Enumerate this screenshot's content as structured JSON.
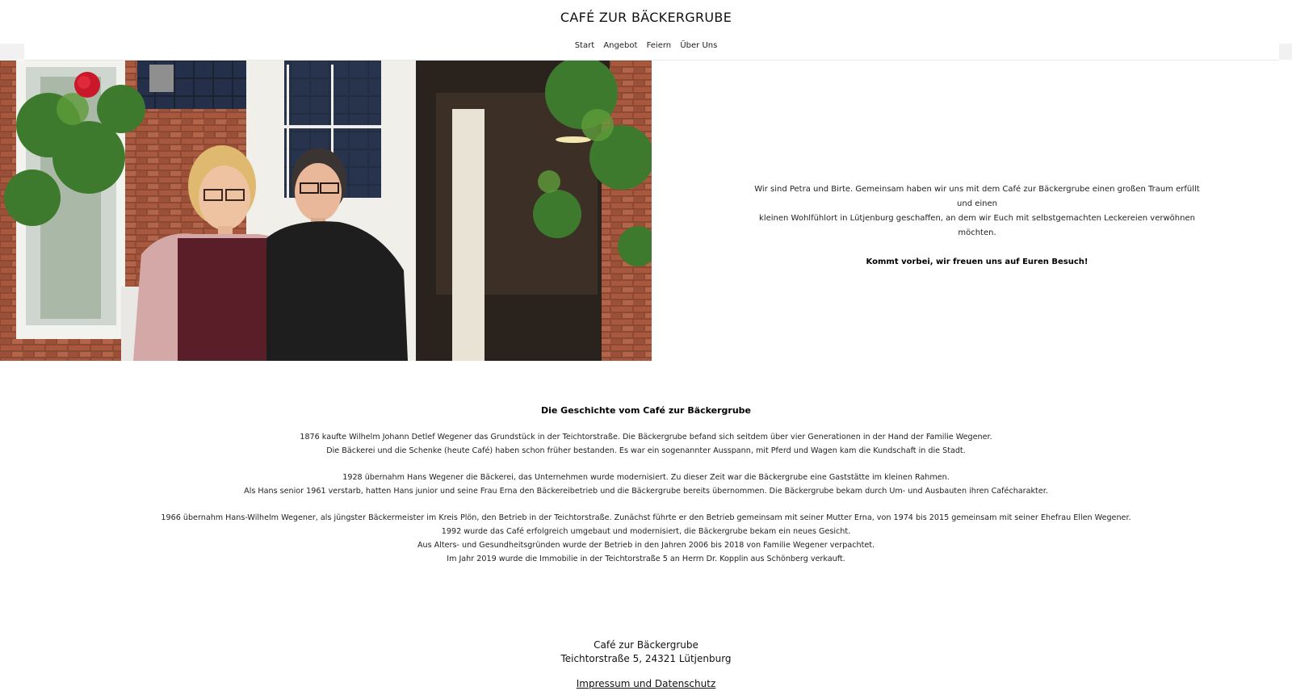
{
  "header": {
    "title": "CAFÉ ZUR BÄCKERGRUBE",
    "nav": [
      "Start",
      "Angebot",
      "Feiern",
      "Über Uns"
    ]
  },
  "intro": {
    "line1": "Wir sind Petra und Birte. Gemeinsam haben wir uns mit dem Café zur Bäckergrube einen großen Traum erfüllt und einen",
    "line2": "kleinen Wohlfühlort in Lütjenburg geschaffen, an dem wir Euch mit selbstgemachten Leckereien verwöhnen möchten.",
    "invite": "Kommt vorbei, wir freuen uns auf Euren Besuch!"
  },
  "history": {
    "heading": "Die Geschichte vom Café zur Bäckergrube",
    "paragraphs": [
      [
        "1876 kaufte Wilhelm Johann Detlef Wegener das Grundstück in der Teichtorstraße. Die Bäckergrube befand sich seitdem über vier Generationen in der Hand der Familie Wegener.",
        "Die Bäckerei und die Schenke (heute Café) haben schon früher bestanden. Es war ein sogenannter Ausspann, mit Pferd und Wagen kam die Kundschaft in die Stadt."
      ],
      [
        "1928 übernahm Hans Wegener die Bäckerei, das Unternehmen wurde modernisiert. Zu dieser Zeit war die Bäckergrube eine Gaststätte im kleinen Rahmen.",
        "Als Hans senior 1961 verstarb, hatten Hans junior und seine Frau Erna den Bäckereibetrieb und die Bäckergrube bereits übernommen. Die Bäckergrube bekam durch Um- und Ausbauten ihren Cafécharakter."
      ],
      [
        "1966 übernahm Hans-Wilhelm Wegener, als jüngster Bäckermeister im Kreis Plön, den Betrieb in der Teichtorstraße. Zunächst führte er den Betrieb gemeinsam mit seiner Mutter Erna, von 1974 bis 2015 gemeinsam mit seiner Ehefrau Ellen Wegener.",
        "1992 wurde das Café erfolgreich umgebaut und modernisiert, die Bäckergrube bekam ein neues Gesicht.",
        "Aus Alters- und Gesundheitsgründen wurde der Betrieb in den Jahren 2006 bis 2018 von Familie Wegener verpachtet.",
        "Im Jahr 2019 wurde die Immobilie in der Teichtorstraße 5 an Herrn Dr. Kopplin aus Schönberg verkauft."
      ]
    ]
  },
  "footer": {
    "name": "Café zur Bäckergrube",
    "address": "Teichtorstraße 5, 24321 Lütjenburg",
    "link": "Impressum und Datenschutz"
  },
  "colors": {
    "background": "#ffffff",
    "text": "#111111",
    "nav_strip": "#f1f1f1"
  }
}
